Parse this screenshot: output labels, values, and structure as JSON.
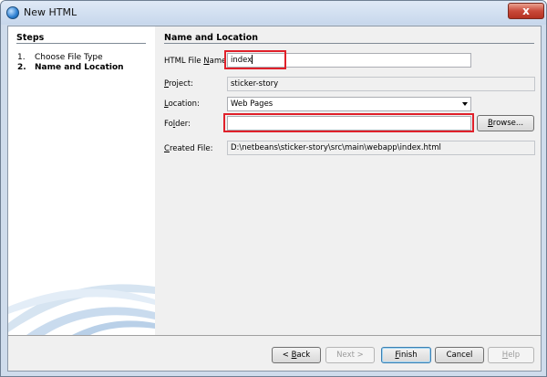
{
  "window": {
    "title": "New HTML",
    "close_glyph": "x"
  },
  "steps": {
    "title": "Steps",
    "items": [
      {
        "num": "1.",
        "label": "Choose File Type"
      },
      {
        "num": "2.",
        "label": "Name and Location"
      }
    ]
  },
  "main": {
    "title": "Name and Location",
    "file_name": {
      "label_pre": "HTML File ",
      "label_ul": "N",
      "label_post": "ame:",
      "value": "index"
    },
    "project": {
      "label_ul": "P",
      "label_post": "roject:",
      "value": "sticker-story"
    },
    "location": {
      "label_ul": "L",
      "label_post": "ocation:",
      "value": "Web Pages"
    },
    "folder": {
      "label_pre": "Fo",
      "label_ul": "l",
      "label_post": "der:",
      "value": ""
    },
    "browse": {
      "label_ul": "B",
      "label_post": "rowse..."
    },
    "created_file": {
      "label_ul": "C",
      "label_post": "reated File:",
      "value": "D:\\netbeans\\sticker-story\\src\\main\\webapp\\index.html"
    }
  },
  "buttons": {
    "back": {
      "pre": "< ",
      "ul": "B",
      "post": "ack"
    },
    "next": "Next >",
    "finish": {
      "ul": "F",
      "post": "inish"
    },
    "cancel": "Cancel",
    "help": {
      "ul": "H",
      "post": "elp"
    }
  },
  "colors": {
    "highlight": "#e0202a",
    "titlebar": "#c7d7ec"
  }
}
